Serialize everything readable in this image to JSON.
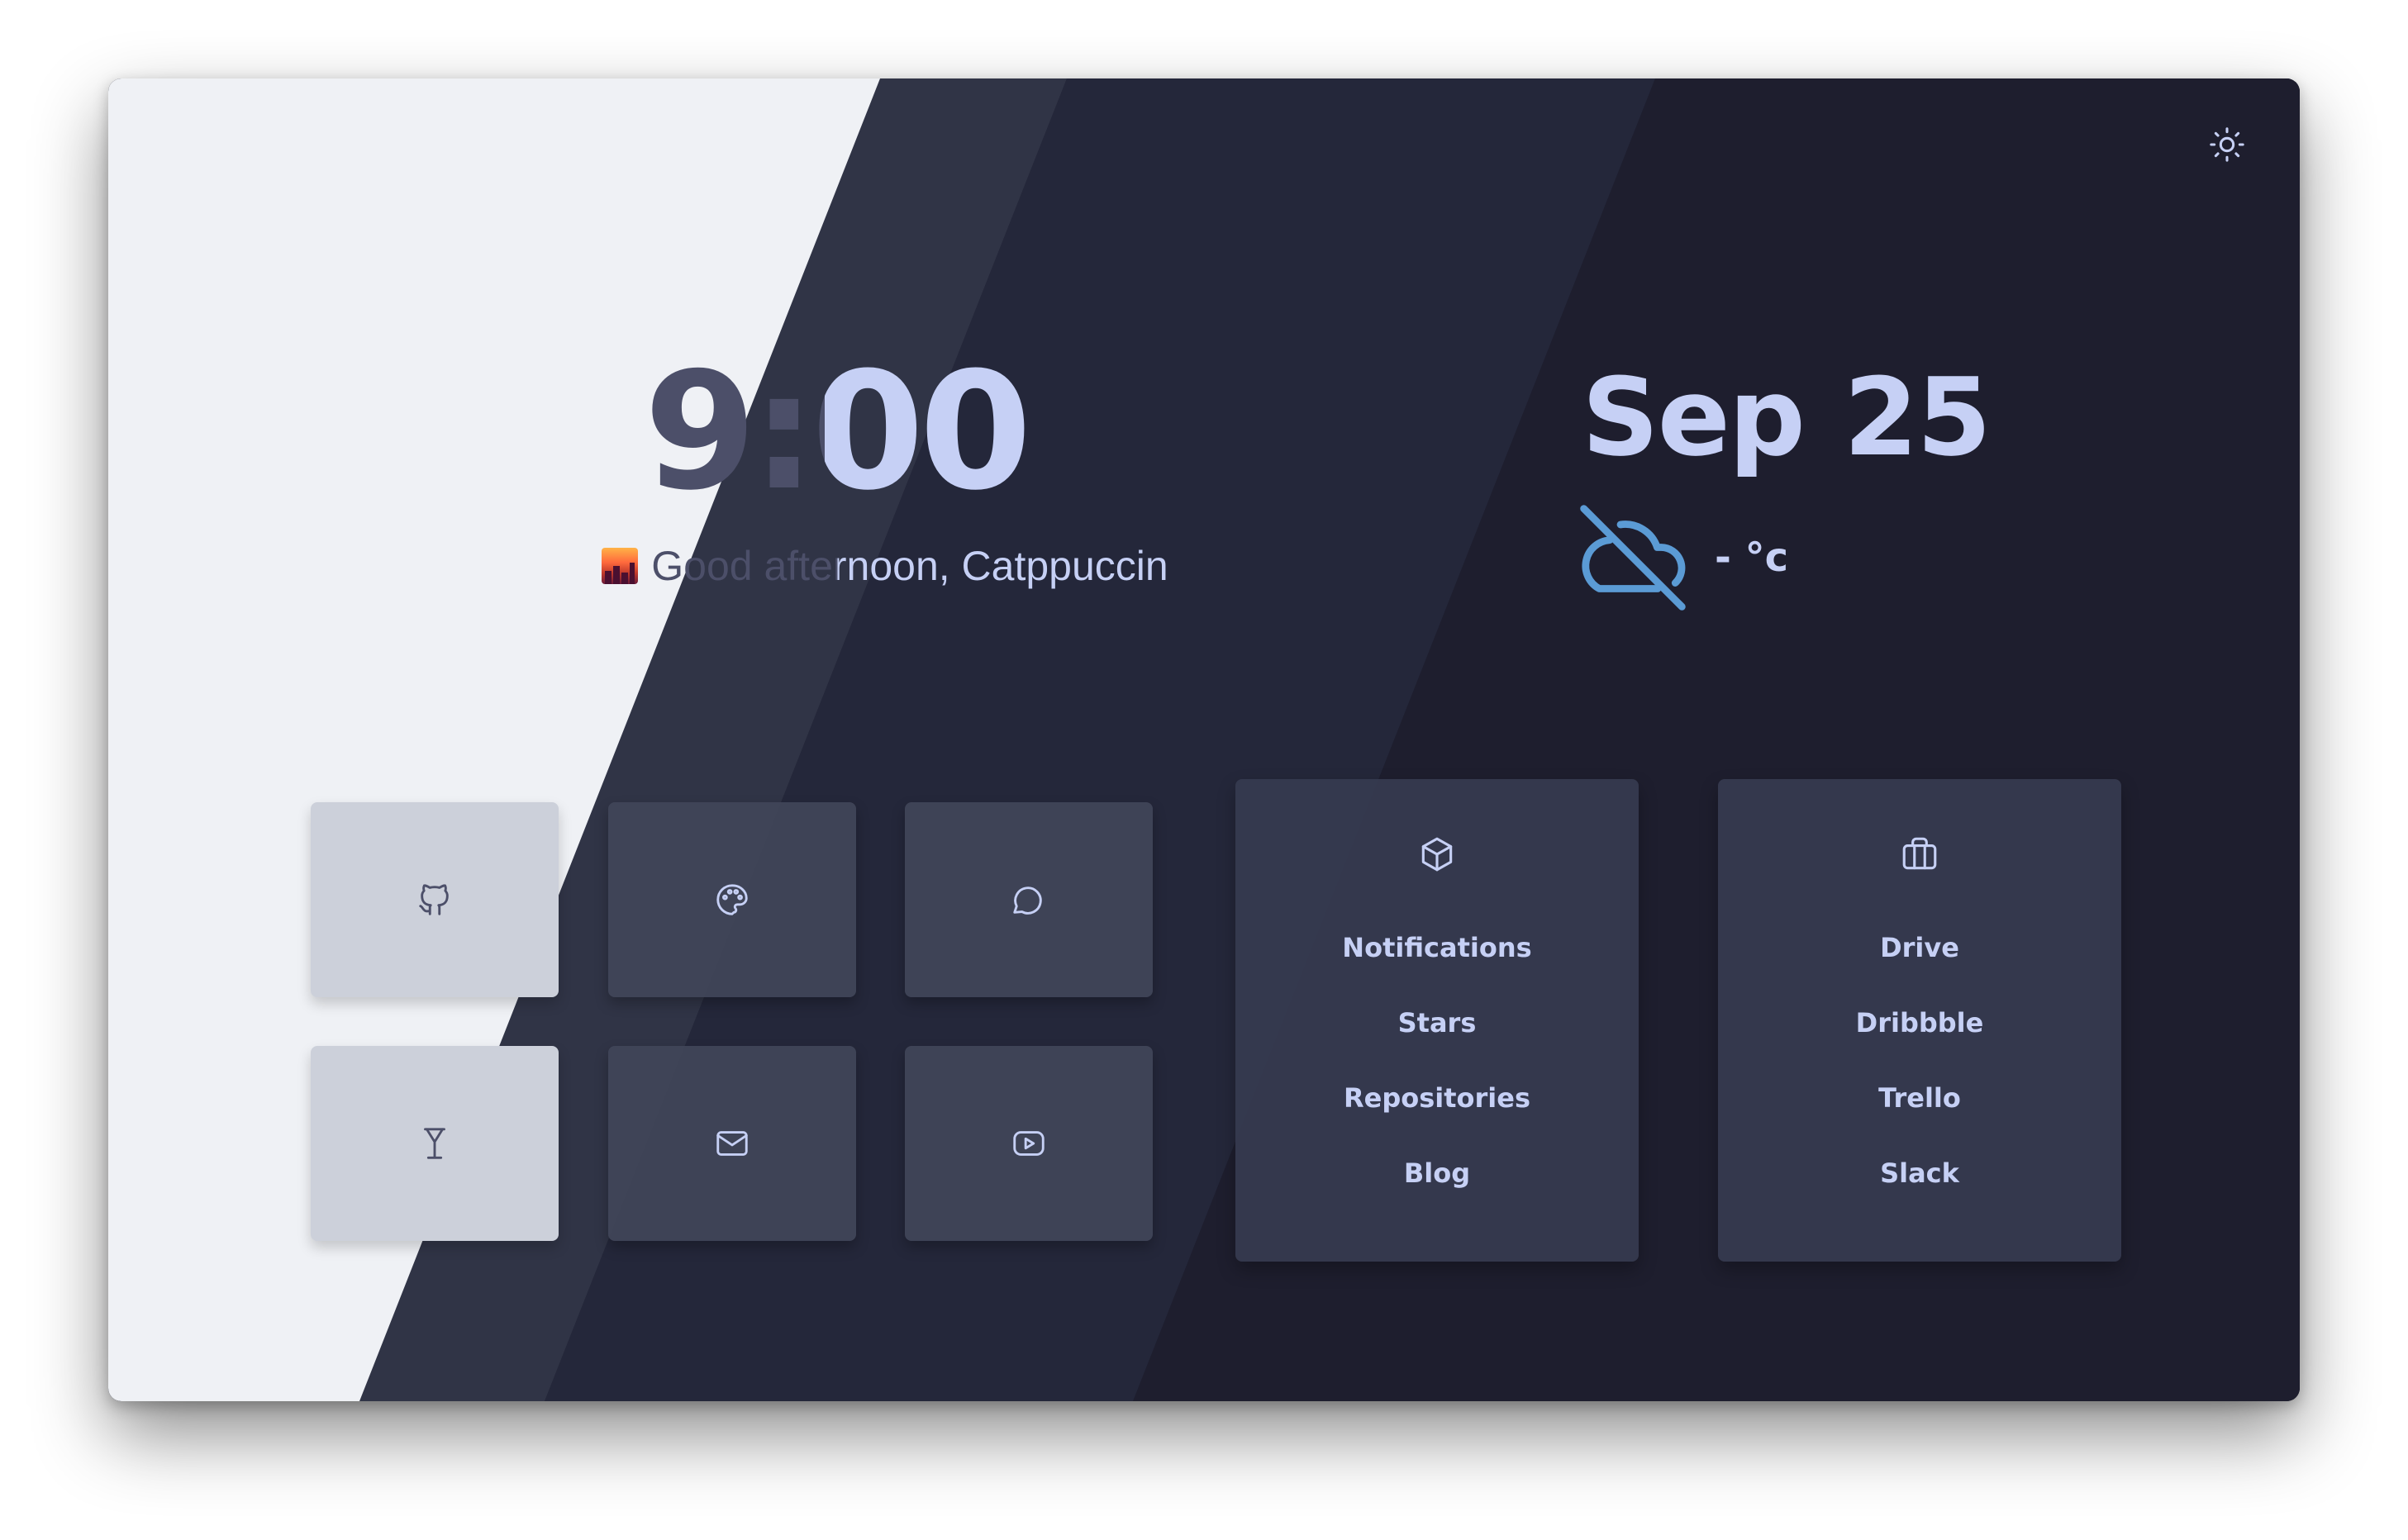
{
  "clock": {
    "time": "9:00"
  },
  "greeting": {
    "emoji": "cityscape-at-dusk-icon",
    "text": "Good afternoon, Catppuccin"
  },
  "date": {
    "month": "Sep",
    "day": "25"
  },
  "weather": {
    "icon": "cloud-off-icon",
    "temperature": "- °c"
  },
  "theme_toggle": {
    "icon": "sun-icon"
  },
  "tiles": [
    {
      "name": "github",
      "icon": "github-icon"
    },
    {
      "name": "palette",
      "icon": "palette-icon"
    },
    {
      "name": "chat",
      "icon": "message-circle-icon"
    },
    {
      "name": "cocktail",
      "icon": "cocktail-icon"
    },
    {
      "name": "mail",
      "icon": "mail-icon"
    },
    {
      "name": "youtube",
      "icon": "youtube-icon"
    }
  ],
  "cards": [
    {
      "icon": "box-icon",
      "links": [
        "Notifications",
        "Stars",
        "Repositories",
        "Blog"
      ]
    },
    {
      "icon": "briefcase-icon",
      "links": [
        "Drive",
        "Dribbble",
        "Trello",
        "Slack"
      ]
    }
  ],
  "colors": {
    "latte_base": "#eff1f5",
    "frappe_base": "#303446",
    "macchiato_base": "#24273a",
    "mocha_base": "#1e1e2e",
    "text_light": "#c6d0f5",
    "text_dark": "#4c4f69",
    "accent_blue": "#5b9bd5"
  }
}
